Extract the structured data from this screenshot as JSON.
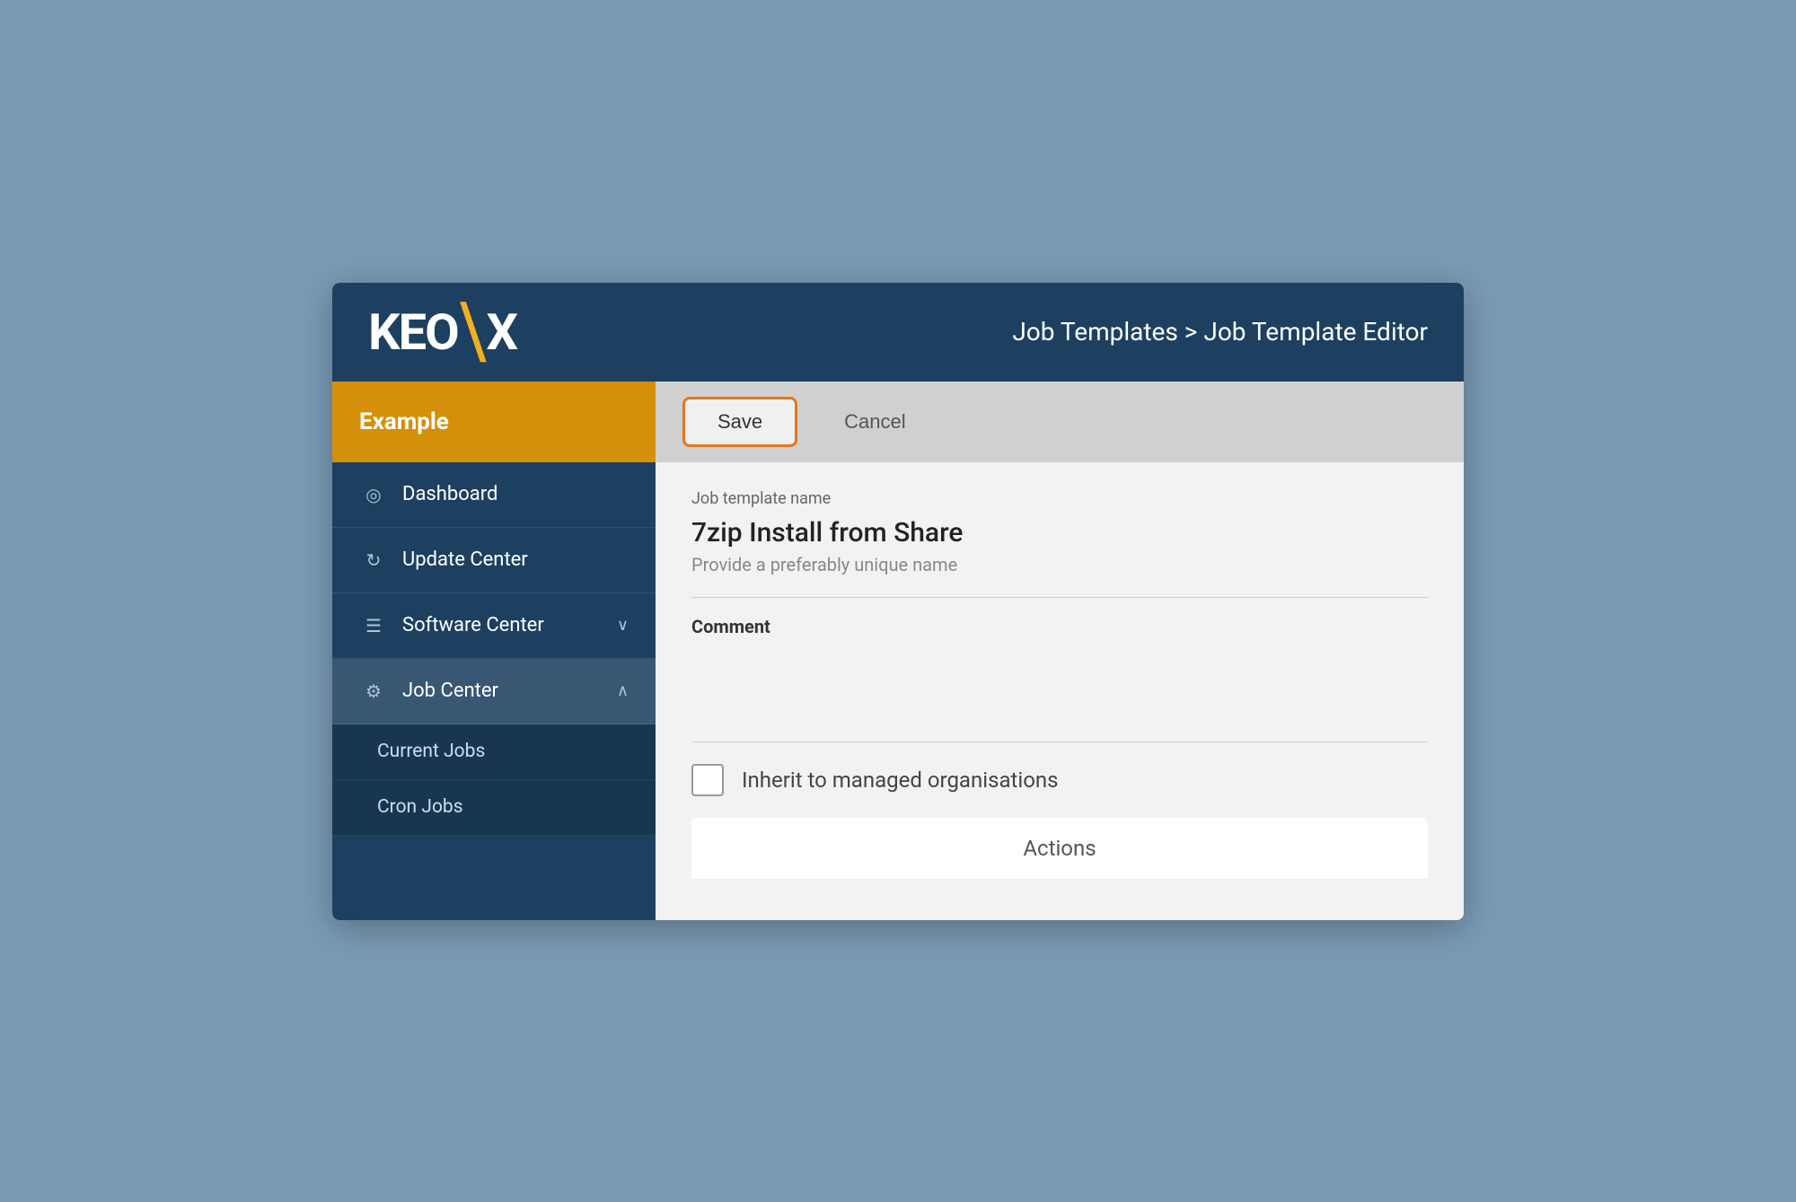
{
  "header": {
    "logo": "KEOX",
    "breadcrumb": "Job Templates > Job Template Editor"
  },
  "sidebar": {
    "brand": "Example",
    "items": [
      {
        "id": "dashboard",
        "label": "Dashboard",
        "icon": "dashboard-icon",
        "hasChevron": false,
        "active": false
      },
      {
        "id": "update-center",
        "label": "Update Center",
        "icon": "update-icon",
        "hasChevron": false,
        "active": false
      },
      {
        "id": "software-center",
        "label": "Software Center",
        "icon": "software-icon",
        "hasChevron": true,
        "chevron": "∨",
        "active": false
      },
      {
        "id": "job-center",
        "label": "Job Center",
        "icon": "jobcenter-icon",
        "hasChevron": true,
        "chevron": "∧",
        "active": true
      }
    ],
    "submenu": [
      {
        "id": "current-jobs",
        "label": "Current Jobs"
      },
      {
        "id": "cron-jobs",
        "label": "Cron Jobs"
      }
    ]
  },
  "toolbar": {
    "save_label": "Save",
    "cancel_label": "Cancel"
  },
  "form": {
    "template_name_label": "Job template name",
    "template_name_value": "7zip Install from Share",
    "template_name_hint": "Provide a preferably unique name",
    "comment_label": "Comment",
    "inherit_label": "Inherit to managed organisations",
    "actions_label": "Actions"
  }
}
